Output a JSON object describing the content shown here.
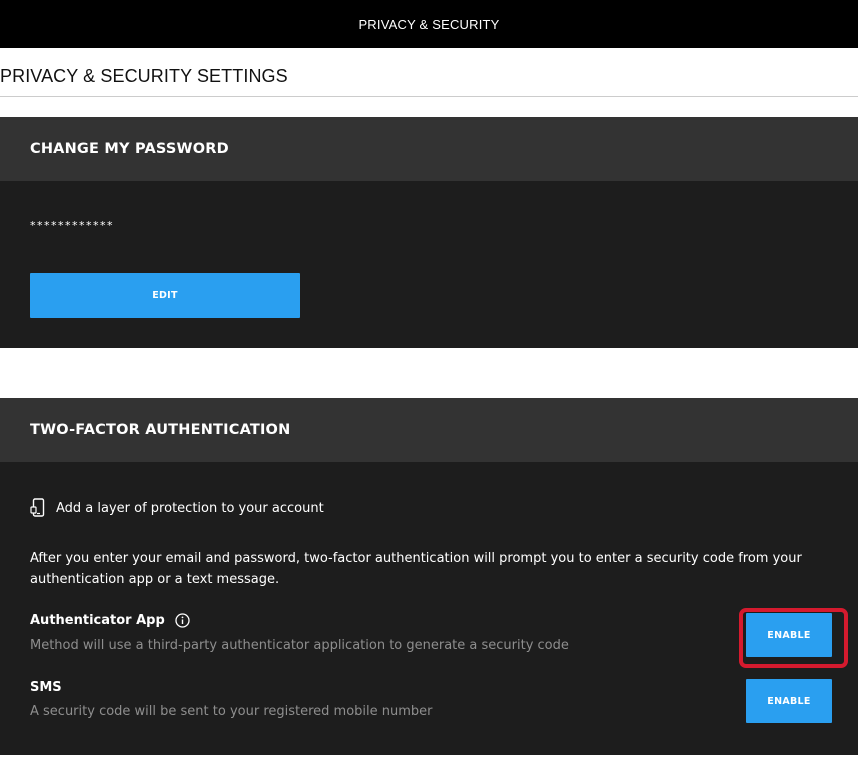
{
  "topbar": {
    "title": "PRIVACY & SECURITY"
  },
  "page": {
    "title": "PRIVACY & SECURITY SETTINGS"
  },
  "password": {
    "header": "CHANGE MY PASSWORD",
    "masked_value": "************",
    "edit_label": "EDIT"
  },
  "two_factor": {
    "header": "TWO-FACTOR AUTHENTICATION",
    "subtitle": "Add a layer of protection to your account",
    "description": "After you enter your email and password, two-factor authentication will prompt you to enter a security code from your authentication app or a text message.",
    "methods": [
      {
        "name": "Authenticator App",
        "note": "Method will use a third-party authenticator application to generate a security code",
        "button_label": "ENABLE"
      },
      {
        "name": "SMS",
        "note": "A security code will be sent to your registered mobile number",
        "button_label": "ENABLE"
      }
    ]
  },
  "colors": {
    "accent": "#2a9ff0",
    "highlight": "#d51a2e",
    "panel_bg": "#1d1d1d",
    "panel_header_bg": "#333333"
  },
  "icons": {
    "phone": "mobile-phone-icon",
    "info": "info-circle-icon"
  }
}
